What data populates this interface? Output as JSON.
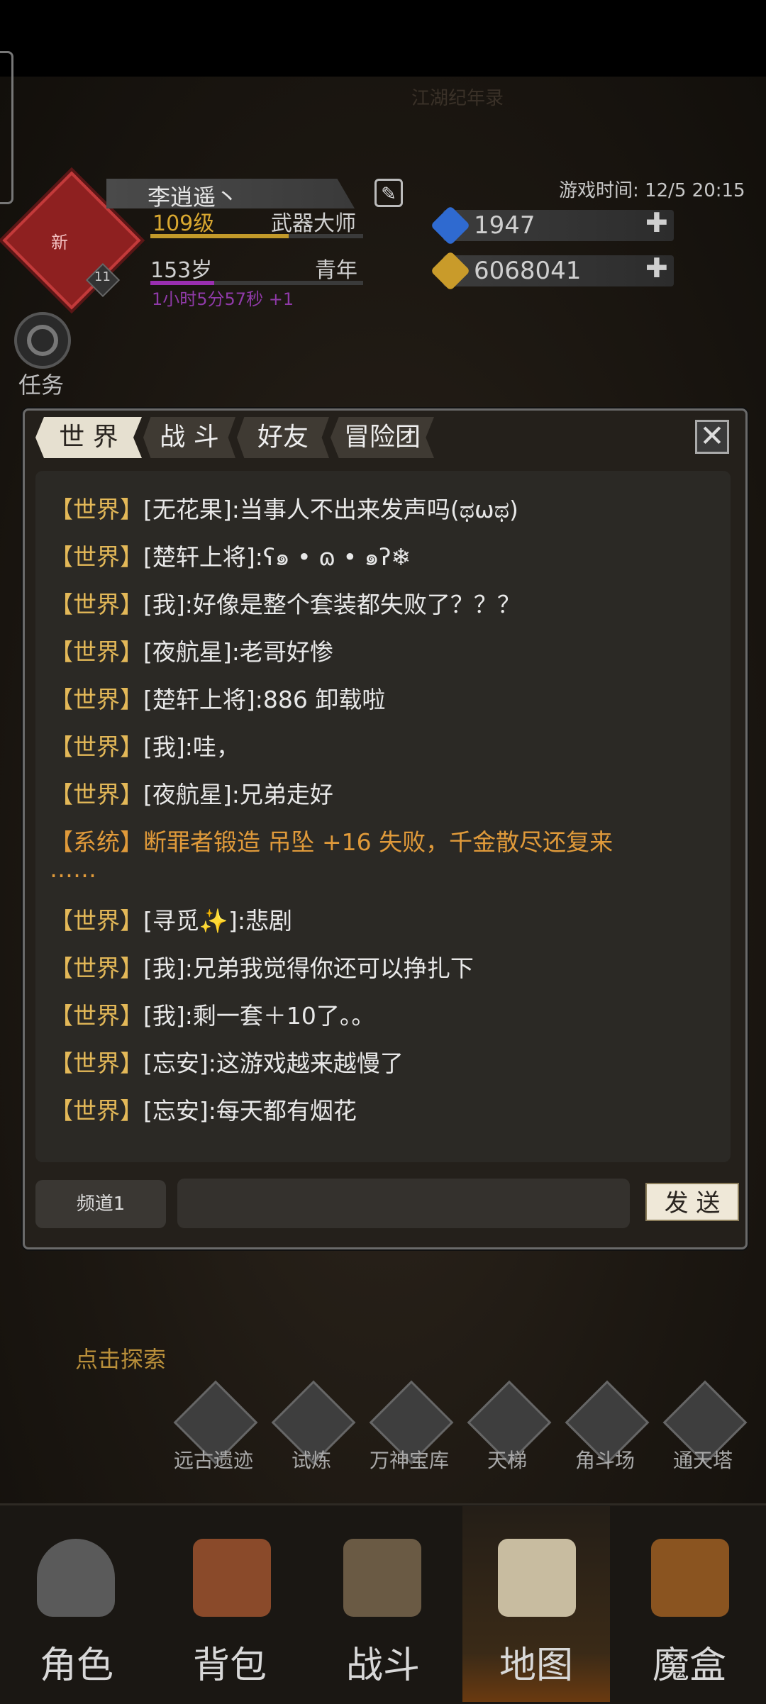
{
  "header": {
    "bg_title": "江湖纪年录",
    "avatar_tag": "新",
    "level_badge": "11",
    "player_name": "李逍遥丶",
    "level": "109级",
    "title": "武器大师",
    "age": "153岁",
    "age_stage": "青年",
    "timer": "1小时5分57秒 +1",
    "game_time": "游戏时间: 12/5 20:15",
    "gems": "1947",
    "gold": "6068041",
    "plus": "✚",
    "task_label": "任务",
    "edit_icon": "✎"
  },
  "chat": {
    "tabs": [
      "世 界",
      "战 斗",
      "好友",
      "冒险团"
    ],
    "close": "✕",
    "messages": [
      {
        "channel": "【世界】",
        "text": "[无花果]:当事人不出来发声吗(ಥωಥ)",
        "system": false
      },
      {
        "channel": "【世界】",
        "text": "[楚轩上将]:ʕ๑ • ɷ • ๑ʔ❄",
        "system": false
      },
      {
        "channel": "【世界】",
        "text": "[我]:好像是整个套装都失败了？？？",
        "system": false
      },
      {
        "channel": "【世界】",
        "text": "[夜航星]:老哥好惨",
        "system": false
      },
      {
        "channel": "【世界】",
        "text": "[楚轩上将]:886 卸载啦",
        "system": false
      },
      {
        "channel": "【世界】",
        "text": "[我]:哇，",
        "system": false
      },
      {
        "channel": "【世界】",
        "text": "[夜航星]:兄弟走好",
        "system": false
      },
      {
        "channel": "【系统】",
        "text": "断罪者锻造 吊坠 +16 失败，千金散尽还复来",
        "system": true
      },
      {
        "channel": "【世界】",
        "text": "[寻觅✨]:悲剧",
        "system": false
      },
      {
        "channel": "【世界】",
        "text": "[我]:兄弟我觉得你还可以挣扎下",
        "system": false
      },
      {
        "channel": "【世界】",
        "text": "[我]:剩一套＋10了。。",
        "system": false
      },
      {
        "channel": "【世界】",
        "text": "[忘安]:这游戏越来越慢了",
        "system": false
      },
      {
        "channel": "【世界】",
        "text": "[忘安]:每天都有烟花",
        "system": false
      }
    ],
    "system_tail": "……",
    "channel_button": "频道1",
    "input_value": "",
    "input_placeholder": "",
    "send_button": "发 送"
  },
  "explore_text": "点击探索",
  "features": [
    "远古遗迹",
    "试炼",
    "万神宝库",
    "天梯",
    "角斗场",
    "通天塔"
  ],
  "nav": {
    "items": [
      "角色",
      "背包",
      "战斗",
      "地图",
      "魔盒"
    ],
    "active": "地图"
  },
  "colors": {
    "world_channel": "#e3b858",
    "system_channel": "#e09a3a",
    "level_bar": "#c39a2a",
    "age_bar": "#9a2fb0",
    "timer_text": "#9a3fb8"
  }
}
